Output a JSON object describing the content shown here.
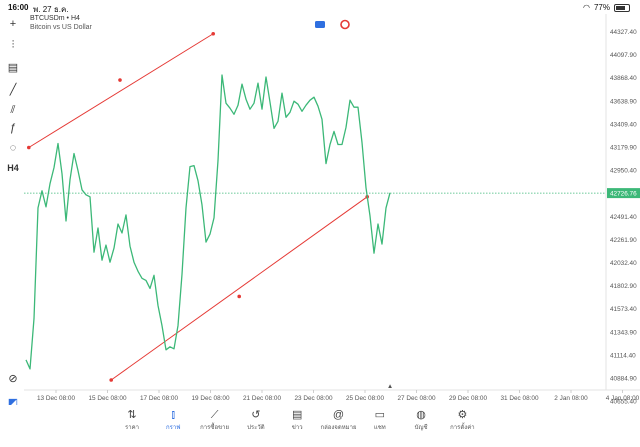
{
  "status": {
    "time": "16:00",
    "date": "พ. 27 ธ.ค.",
    "battery": "77%"
  },
  "symbol": {
    "line1": "BTCUSDm • H4",
    "line2": "Bitcoin vs US Dollar"
  },
  "toolbar": [
    {
      "name": "crosshair-icon",
      "glyph": "+"
    },
    {
      "name": "indicators-icon",
      "glyph": "⫶"
    },
    {
      "name": "timeframe-icon",
      "glyph": "▤"
    },
    {
      "name": "line-tool-icon",
      "glyph": "╱"
    },
    {
      "name": "channel-tool-icon",
      "glyph": "⫽"
    },
    {
      "name": "fibonacci-icon",
      "glyph": "ƒ"
    },
    {
      "name": "shapes-icon",
      "glyph": "◌"
    },
    {
      "name": "period-button",
      "glyph": "H4"
    }
  ],
  "chart_data": {
    "type": "line",
    "y_ticks": [
      "44327.40",
      "44097.90",
      "43868.40",
      "43638.90",
      "43409.40",
      "43179.90",
      "42950.40",
      "42726.76",
      "42491.40",
      "42261.90",
      "42032.40",
      "41802.90",
      "41573.40",
      "41343.90",
      "41114.40",
      "40884.90",
      "40655.40"
    ],
    "x_ticks": [
      "13 Dec 08:00",
      "15 Dec 08:00",
      "17 Dec 08:00",
      "19 Dec 08:00",
      "21 Dec 08:00",
      "23 Dec 08:00",
      "25 Dec 08:00",
      "27 Dec 08:00",
      "29 Dec 08:00",
      "31 Dec 08:00",
      "2 Jan 08:00",
      "4 Jan 08:00"
    ],
    "ylim": [
      40560,
      44450
    ],
    "current_price": 42726.76,
    "series": [
      {
        "values": [
          41070,
          40980,
          41480,
          42580,
          42750,
          42590,
          42820,
          42980,
          43220,
          42920,
          42450,
          42860,
          43120,
          42950,
          42760,
          42710,
          42690,
          42140,
          42380,
          42060,
          42210,
          42040,
          42180,
          42420,
          42330,
          42510,
          42200,
          42040,
          41950,
          41880,
          41860,
          41780,
          41910,
          41610,
          41410,
          41170,
          41200,
          41180,
          41410,
          41920,
          42580,
          42990,
          43000,
          42850,
          42610,
          42240,
          42320,
          42480,
          43050,
          43900,
          43620,
          43570,
          43510,
          43600,
          43810,
          43660,
          43560,
          43620,
          43820,
          43560,
          43880,
          43630,
          43370,
          43440,
          43720,
          43480,
          43530,
          43640,
          43610,
          43540,
          43600,
          43650,
          43680,
          43590,
          43460,
          43020,
          43210,
          43340,
          43210,
          43210,
          43380,
          43650,
          43580,
          43580,
          43230,
          42780,
          42500,
          42130,
          42420,
          42220,
          42580,
          42730
        ]
      }
    ],
    "trend_lines": [
      {
        "points": [
          [
            0.7,
            43180
          ],
          [
            23.5,
            43850
          ],
          [
            46.8,
            44310
          ]
        ]
      },
      {
        "points": [
          [
            21.3,
            40870
          ],
          [
            53.3,
            41700
          ],
          [
            85.3,
            42690
          ]
        ]
      }
    ]
  },
  "tabs": [
    {
      "name": "tab-quotes",
      "label": "ราคา",
      "glyph": "⇅"
    },
    {
      "name": "tab-chart",
      "label": "กราฟ",
      "glyph": "⫾"
    },
    {
      "name": "tab-trade",
      "label": "การซื้อขาย",
      "glyph": "⟋"
    },
    {
      "name": "tab-history",
      "label": "ประวัติ",
      "glyph": "↺"
    },
    {
      "name": "tab-news",
      "label": "ข่าว",
      "glyph": "▤"
    },
    {
      "name": "tab-mailbox",
      "label": "กล่องจดหมาย",
      "glyph": "@"
    },
    {
      "name": "tab-chat",
      "label": "แชท",
      "glyph": "▭"
    },
    {
      "name": "tab-accounts",
      "label": "บัญชี",
      "glyph": "◍"
    },
    {
      "name": "tab-settings",
      "label": "การตั้งค่า",
      "glyph": "⚙"
    }
  ],
  "colors": {
    "line": "#3cb878",
    "trend": "#e53935",
    "accent": "#2f6fe0"
  }
}
